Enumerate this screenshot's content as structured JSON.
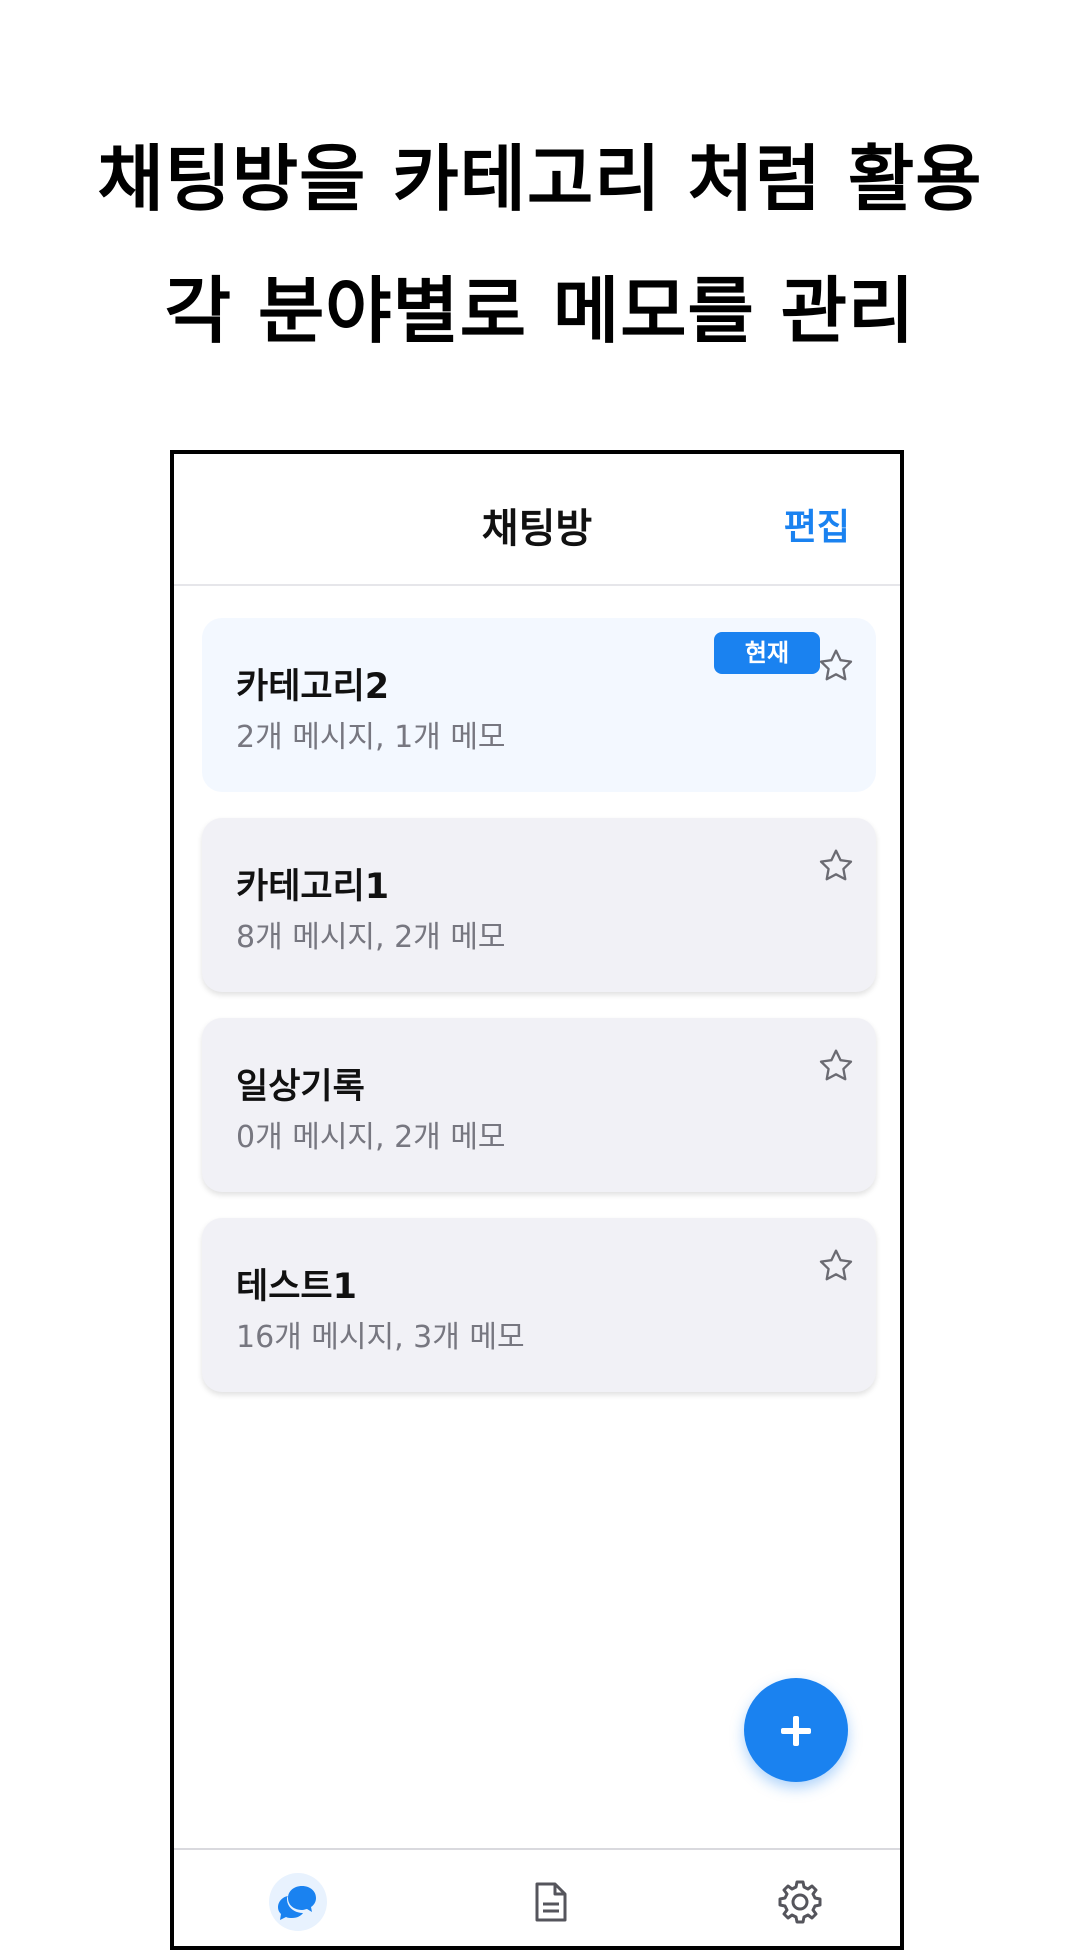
{
  "promo": {
    "line1": "채팅방을 카테고리 처럼 활용",
    "line2": "각 분야별로 메모를 관리"
  },
  "header": {
    "title": "채팅방",
    "edit_label": "편집"
  },
  "rooms": [
    {
      "name": "카테고리2",
      "stats": "2개 메시지, 1개 메모",
      "current": true,
      "badge": "현재",
      "favorite": false
    },
    {
      "name": "카테고리1",
      "stats": "8개 메시지, 2개 메모",
      "current": false,
      "favorite": false
    },
    {
      "name": "일상기록",
      "stats": "0개 메시지, 2개 메모",
      "current": false,
      "favorite": false
    },
    {
      "name": "테스트1",
      "stats": "16개 메시지, 3개 메모",
      "current": false,
      "favorite": false
    }
  ],
  "fab": {
    "icon": "plus-icon"
  },
  "tabs": [
    {
      "icon": "chat-bubbles-icon",
      "active": true
    },
    {
      "icon": "document-icon",
      "active": false
    },
    {
      "icon": "gear-icon",
      "active": false
    }
  ],
  "colors": {
    "accent": "#1a82f0",
    "card_bg": "#f1f1f6",
    "current_card_bg": "#f3f8ff",
    "muted_text": "#777780"
  }
}
